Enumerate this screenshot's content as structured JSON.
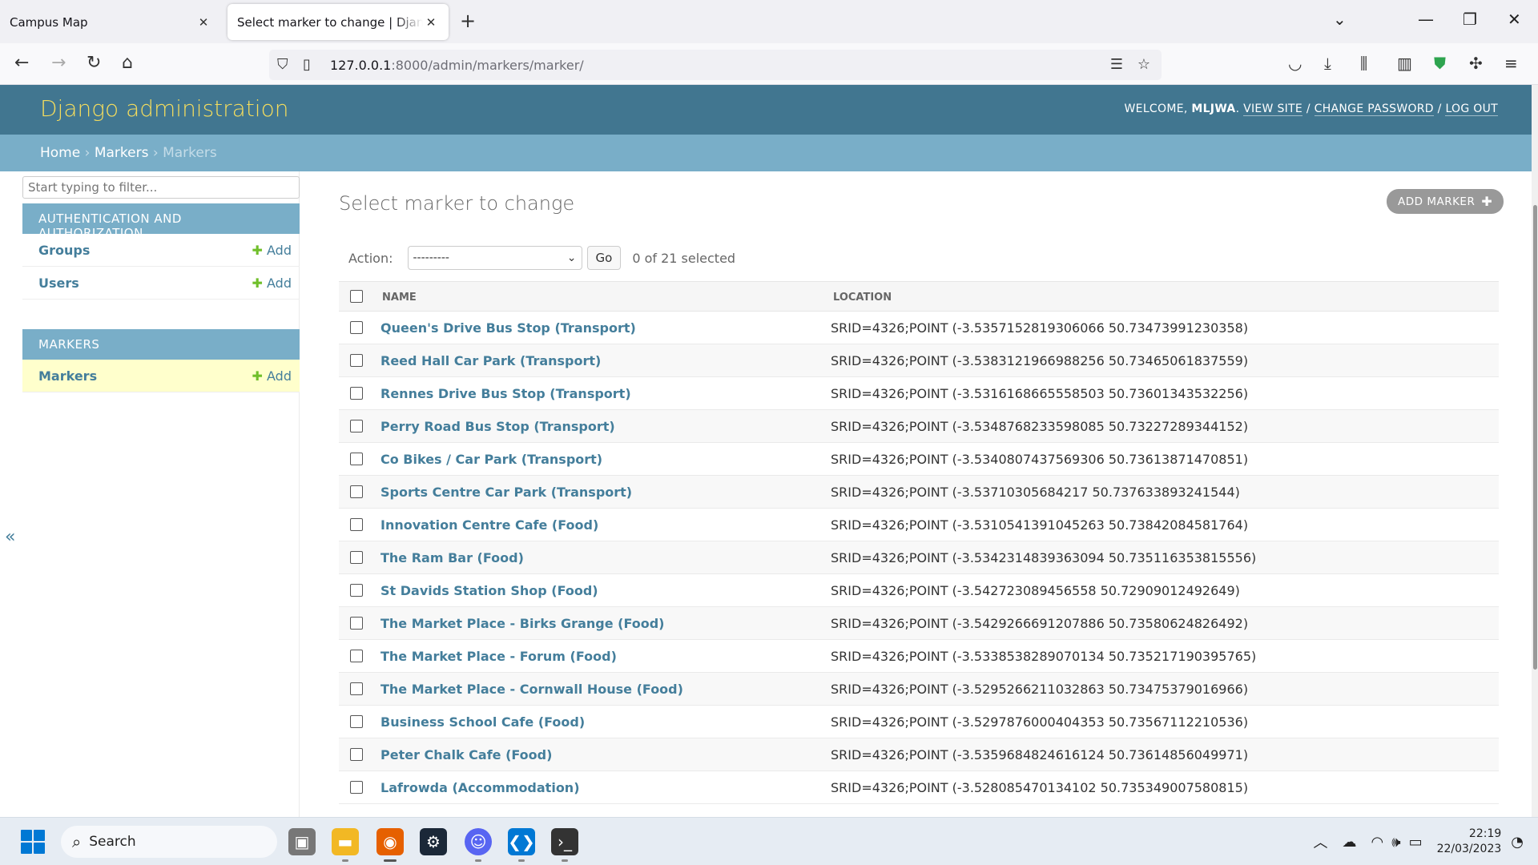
{
  "browser": {
    "tabs": [
      {
        "title": "Campus Map"
      },
      {
        "title": "Select marker to change | Django site admin"
      }
    ],
    "url_host": "127.0.0.1",
    "url_rest": ":8000/admin/markers/marker/"
  },
  "header": {
    "branding": "Django administration",
    "welcome": "WELCOME,",
    "username": "MLJWA",
    "view_site": "VIEW SITE",
    "change_password": "CHANGE PASSWORD",
    "log_out": "LOG OUT",
    "sep": "/"
  },
  "breadcrumbs": {
    "home": "Home",
    "app": "Markers",
    "current": "Markers",
    "sep": "›"
  },
  "sidebar": {
    "filter_placeholder": "Start typing to filter...",
    "auth_caption": "AUTHENTICATION AND AUTHORIZATION",
    "groups": "Groups",
    "users": "Users",
    "markers_caption": "MARKERS",
    "markers": "Markers",
    "add_label": "Add",
    "toggle_icon": "«"
  },
  "content": {
    "title": "Select marker to change",
    "add_button": "ADD MARKER",
    "action_label": "Action:",
    "action_value": "---------",
    "go_label": "Go",
    "selected_text": "0 of 21 selected",
    "col_name": "NAME",
    "col_location": "LOCATION",
    "rows": [
      {
        "name": "Queen's Drive Bus Stop (Transport)",
        "location": "SRID=4326;POINT (-3.5357152819306066 50.73473991230358)"
      },
      {
        "name": "Reed Hall Car Park (Transport)",
        "location": "SRID=4326;POINT (-3.5383121966988256 50.73465061837559)"
      },
      {
        "name": "Rennes Drive Bus Stop (Transport)",
        "location": "SRID=4326;POINT (-3.5316168665558503 50.73601343532256)"
      },
      {
        "name": "Perry Road Bus Stop (Transport)",
        "location": "SRID=4326;POINT (-3.5348768233598085 50.73227289344152)"
      },
      {
        "name": "Co Bikes / Car Park (Transport)",
        "location": "SRID=4326;POINT (-3.5340807437569306 50.73613871470851)"
      },
      {
        "name": "Sports Centre Car Park (Transport)",
        "location": "SRID=4326;POINT (-3.53710305684217 50.737633893241544)"
      },
      {
        "name": "Innovation Centre Cafe (Food)",
        "location": "SRID=4326;POINT (-3.5310541391045263 50.73842084581764)"
      },
      {
        "name": "The Ram Bar (Food)",
        "location": "SRID=4326;POINT (-3.5342314839363094 50.735116353815556)"
      },
      {
        "name": "St Davids Station Shop (Food)",
        "location": "SRID=4326;POINT (-3.542723089456558 50.72909012492649)"
      },
      {
        "name": "The Market Place - Birks Grange (Food)",
        "location": "SRID=4326;POINT (-3.5429266691207886 50.73580624826492)"
      },
      {
        "name": "The Market Place - Forum (Food)",
        "location": "SRID=4326;POINT (-3.5338538289070134 50.735217190395765)"
      },
      {
        "name": "The Market Place - Cornwall House (Food)",
        "location": "SRID=4326;POINT (-3.5295266211032863 50.73475379016966)"
      },
      {
        "name": "Business School Cafe (Food)",
        "location": "SRID=4326;POINT (-3.5297876000404353 50.73567112210536)"
      },
      {
        "name": "Peter Chalk Cafe (Food)",
        "location": "SRID=4326;POINT (-3.5359684824616124 50.73614856049971)"
      },
      {
        "name": "Lafrowda (Accommodation)",
        "location": "SRID=4326;POINT (-3.528085470134102 50.735349007580815)"
      }
    ]
  },
  "taskbar": {
    "search_label": "Search",
    "time": "22:19",
    "date": "22/03/2023"
  },
  "colors": {
    "header_bg": "#417690",
    "branding": "#f5dd5d",
    "breadcrumb_bg": "#79aec8",
    "link": "#447e9b",
    "add_green": "#70bf2b",
    "selected_row": "#ffffcc"
  }
}
